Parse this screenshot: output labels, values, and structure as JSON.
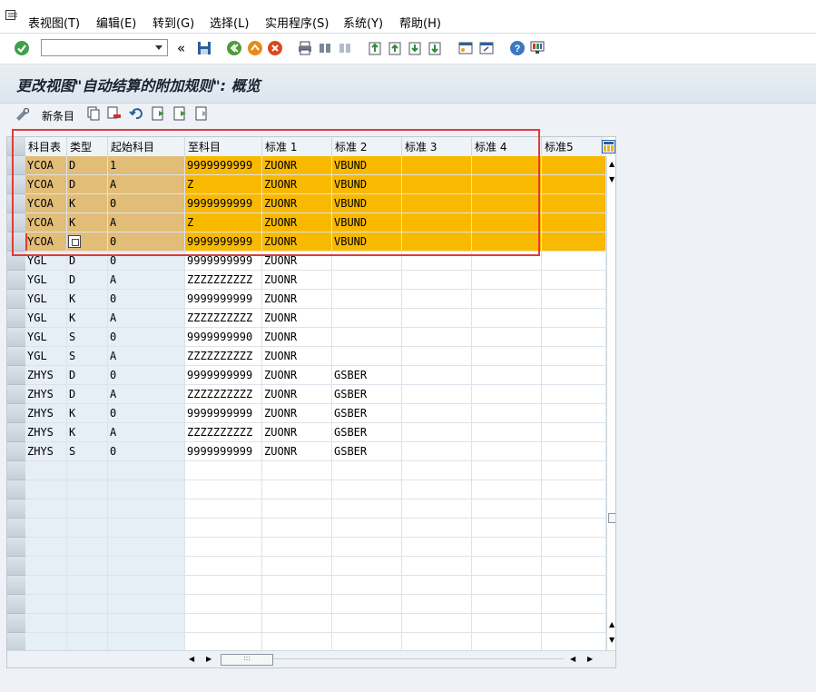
{
  "menu": {
    "items": [
      "表视图(T)",
      "编辑(E)",
      "转到(G)",
      "选择(L)",
      "实用程序(S)",
      "系统(Y)",
      "帮助(H)"
    ]
  },
  "command_field": {
    "value": ""
  },
  "page_title": "更改视图\"自动结算的附加规则\": 概览",
  "app_toolbar": {
    "new_entries_label": "新条目"
  },
  "table": {
    "columns": [
      "科目表",
      "类型",
      "起始科目",
      "至科目",
      "标准 1",
      "标准 2",
      "标准 3",
      "标准 4",
      "标准5"
    ],
    "rows": [
      [
        "YCOA",
        "D",
        "1",
        "9999999999",
        "ZUONR",
        "VBUND",
        "",
        ""
      ],
      [
        "YCOA",
        "D",
        "A",
        "Z",
        "ZUONR",
        "VBUND",
        "",
        ""
      ],
      [
        "YCOA",
        "K",
        "0",
        "9999999999",
        "ZUONR",
        "VBUND",
        "",
        ""
      ],
      [
        "YCOA",
        "K",
        "A",
        "Z",
        "ZUONR",
        "VBUND",
        "",
        ""
      ],
      [
        "YCOA",
        "",
        "0",
        "9999999999",
        "ZUONR",
        "VBUND",
        "",
        ""
      ],
      [
        "YGL",
        "D",
        "0",
        "9999999999",
        "ZUONR",
        "",
        "",
        ""
      ],
      [
        "YGL",
        "D",
        "A",
        "ZZZZZZZZZZ",
        "ZUONR",
        "",
        "",
        ""
      ],
      [
        "YGL",
        "K",
        "0",
        "9999999999",
        "ZUONR",
        "",
        "",
        ""
      ],
      [
        "YGL",
        "K",
        "A",
        "ZZZZZZZZZZ",
        "ZUONR",
        "",
        "",
        ""
      ],
      [
        "YGL",
        "S",
        "0",
        "9999999990",
        "ZUONR",
        "",
        "",
        ""
      ],
      [
        "YGL",
        "S",
        "A",
        "ZZZZZZZZZZ",
        "ZUONR",
        "",
        "",
        ""
      ],
      [
        "ZHYS",
        "D",
        "0",
        "9999999999",
        "ZUONR",
        "GSBER",
        "",
        ""
      ],
      [
        "ZHYS",
        "D",
        "A",
        "ZZZZZZZZZZ",
        "ZUONR",
        "GSBER",
        "",
        ""
      ],
      [
        "ZHYS",
        "K",
        "0",
        "9999999999",
        "ZUONR",
        "GSBER",
        "",
        ""
      ],
      [
        "ZHYS",
        "K",
        "A",
        "ZZZZZZZZZZ",
        "ZUONR",
        "GSBER",
        "",
        ""
      ],
      [
        "ZHYS",
        "S",
        "0",
        "9999999999",
        "ZUONR",
        "GSBER",
        "",
        ""
      ]
    ],
    "selected_rows": 5,
    "empty_rows": 10
  },
  "colors": {
    "selected_key": "#e2bd77",
    "selected_data": "#f9b900",
    "key_column": "#e6eef6",
    "highlight_border": "#e03a3a"
  }
}
